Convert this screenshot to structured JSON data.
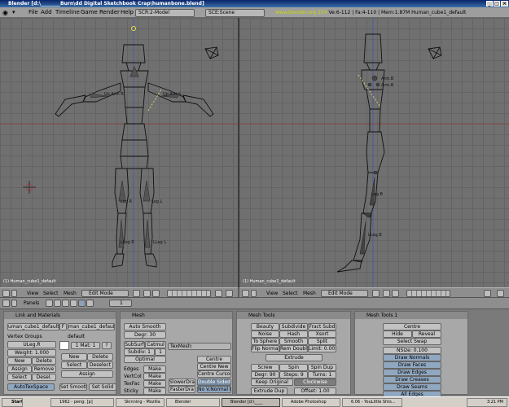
{
  "window_title": "Blender [d:\\________Burn\\dd Digital Sketchbook Crap\\humanbone.blend]",
  "menu": [
    "File",
    "Add",
    "Timeline",
    "Game",
    "Render",
    "Help"
  ],
  "screen_field": "SCR:2-Model",
  "scene_field": "SCE:Scene",
  "status": {
    "url": "www.blender.org 234",
    "info": "Ve:6-112 | Fa:4-110 | Mem:1.87M Human_cube1_default"
  },
  "viewport_label": "(1) Human_cube1_default",
  "bone_labels": {
    "upper_arm_r": "Up Arm R",
    "upper_arm_l": "Up Arm L",
    "leg_r": "Leg R",
    "leg_l": "Leg L",
    "lleg_r": "LLeg R",
    "lleg_l": "LLeg L",
    "side_a": "Arm.B",
    "side_b": "Arm.B",
    "side_leg": "Leg.B",
    "side_lleg": "LLeg.B"
  },
  "view_header": {
    "view": "View",
    "select": "Select",
    "mesh": "Mesh",
    "mode": "Edit Mode"
  },
  "buttons_header": {
    "panels": "Panels",
    "frame": "1"
  },
  "panel_link": {
    "title": "Link and Materials",
    "me_field": "uman_cube1_default",
    "f_flag": "F",
    "ob_field": "man_cube1_default",
    "vgroups_label": "Vertex Groups",
    "vgroup": "ULeg.R",
    "weight": "Weight: 1.000",
    "new": "New",
    "delete": "Delete",
    "assign": "Assign",
    "remove": "Remove",
    "select": "Select",
    "deselect": "Desel.",
    "mat_label": "default",
    "mat_count": "1 Mat: 1",
    "mat_q": "?",
    "mat_new": "New",
    "mat_delete": "Delete",
    "mat_select": "Select",
    "mat_deselect": "Deselect",
    "mat_assign": "Assign",
    "autotex": "AutoTexSpace",
    "set_smooth": "Set Smooth",
    "set_solid": "Set Solid"
  },
  "panel_mesh": {
    "title": "Mesh",
    "auto_smooth": "Auto Smooth",
    "degr": "Degr: 30",
    "subsurf": "SubSurf",
    "catmul": "Catmul",
    "subdiv": "Subdiv: 1",
    "subdiv2": "1",
    "optimal": "Optimal",
    "texmesh": "TexMesh:",
    "edges": "Edges",
    "vertcol": "VertCol",
    "texface": "TexFac",
    "sticky": "Sticky",
    "make": "Make",
    "centre": "Centre",
    "centre_new": "Centre New",
    "centre_cursor": "Centre Cursor",
    "slower": "SlowerDra",
    "faster": "FasterDra",
    "double_sided": "Double Sided",
    "no_v_normal": "No V.Normal Fl"
  },
  "panel_tools": {
    "title": "Mesh Tools",
    "beauty": "Beauty",
    "subdivide": "Subdivide",
    "fract_subd": "Fract Subd",
    "noise": "Noise",
    "hash": "Hash",
    "xsort": "Xsort",
    "to_sphere": "To Sphere",
    "smooth": "Smooth",
    "split": "Split",
    "flip_normal": "Flip Normal",
    "rem_double": "Rem Double",
    "limit": "Limit: 0.001",
    "extrude": "Extrude",
    "screw": "Screw",
    "spin": "Spin",
    "spin_dup": "Spin Dup",
    "degr": "Degr: 90",
    "steps": "Steps: 9",
    "turns": "Turns: 1",
    "keep_original": "Keep Original",
    "clockwise": "Clockwise",
    "extrude_dup": "Extrude Dup",
    "offset": "Offset: 1.00"
  },
  "panel_tools1": {
    "title": "Mesh Tools 1",
    "centre": "Centre",
    "hide": "Hide",
    "reveal": "Reveal",
    "select_swap": "Select Swap",
    "nsize": "NSize: 0.100",
    "draw_normals": "Draw Normals",
    "draw_faces": "Draw Faces",
    "draw_edges": "Draw Edges",
    "draw_creases": "Draw Creases",
    "draw_seams": "Draw Seams",
    "all_edges": "All Edges"
  },
  "taskbar": {
    "start": "Start",
    "tasks": [
      "1962 - peng: [p]",
      "Skinning - Mozilla",
      "Blender",
      "Blender [d:\\____",
      "Adobe Photoshop",
      "6.06 - YouLittle Shts..."
    ],
    "clock": "3:21 PM"
  }
}
